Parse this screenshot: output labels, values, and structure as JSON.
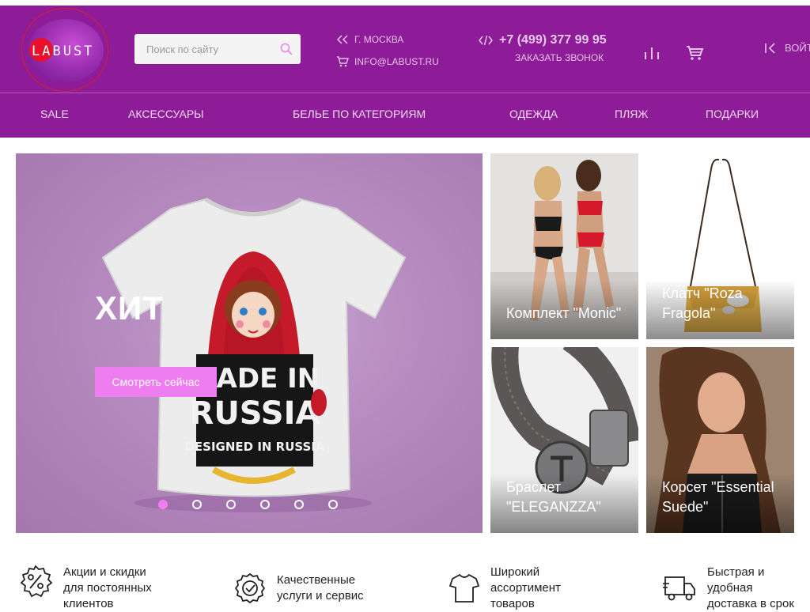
{
  "logo": {
    "text": "LABUST"
  },
  "search": {
    "placeholder": "Поиск по сайту"
  },
  "contact": {
    "city": "г. Москва",
    "email": "info@labust.ru"
  },
  "phone": {
    "number": "+7 (499) 377 99 95",
    "callback_label": "Заказать звонок"
  },
  "login": {
    "label": "Войти"
  },
  "nav": {
    "items": [
      "SALE",
      "Аксессуары",
      "Белье по категориям",
      "Одежда",
      "Пляж",
      "Подарки"
    ]
  },
  "hero": {
    "title": "ХИТ",
    "button_label": "Смотреть сейчас",
    "shirt_print": {
      "line1": "MADE IN",
      "line2": "RUSSIA",
      "line3": "DESIGNED IN RUSSIA"
    },
    "slide_count": 6,
    "active_slide": 1
  },
  "tiles": [
    {
      "name": "Комплект \"Monic\""
    },
    {
      "name": "Клатч \"Roza Fragola\""
    },
    {
      "name": "Браслет \"ELEGANZZA\""
    },
    {
      "name": "Корсет \"Essential Suede\""
    }
  ],
  "features": [
    {
      "icon": "discount-percent-icon",
      "text": "Акции и скидки для постоянных клиентов"
    },
    {
      "icon": "quality-badge-icon",
      "text": "Качественные услуги и сервис"
    },
    {
      "icon": "tshirt-icon",
      "text": "Широкий ассортимент товаров"
    },
    {
      "icon": "delivery-truck-icon",
      "text": "Быстрая и удобная доставка в срок"
    }
  ],
  "colors": {
    "header": "#8e1b97",
    "accent_pink": "#ee7df0",
    "nav_text": "#f3dcf6"
  }
}
